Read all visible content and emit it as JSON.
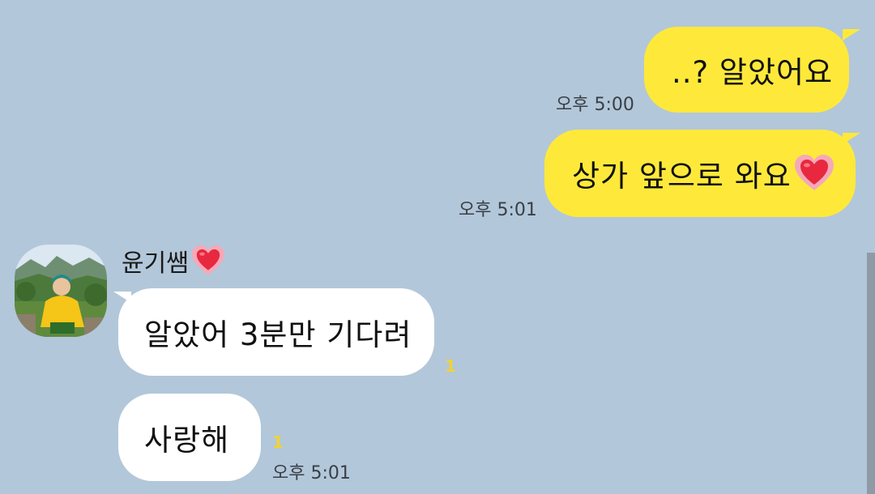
{
  "chat": {
    "messages": [
      {
        "text": "..? 알았어요",
        "time": "오후 5:00"
      },
      {
        "text": "상가 앞으로 와요",
        "time": "오후 5:01"
      },
      {
        "text": "알았어 3분만 기다려",
        "unread": "1"
      },
      {
        "text": "사랑해",
        "unread": "1",
        "time": "오후 5:01"
      }
    ],
    "sender": {
      "name": "윤기쌤"
    }
  },
  "colors": {
    "background": "#b2c7da",
    "outgoing_bubble": "#fee93a",
    "incoming_bubble": "#ffffff",
    "unread_count": "#f2d233"
  },
  "icons": {
    "heart": "heart-emoji-icon",
    "avatar": "profile-photo"
  }
}
